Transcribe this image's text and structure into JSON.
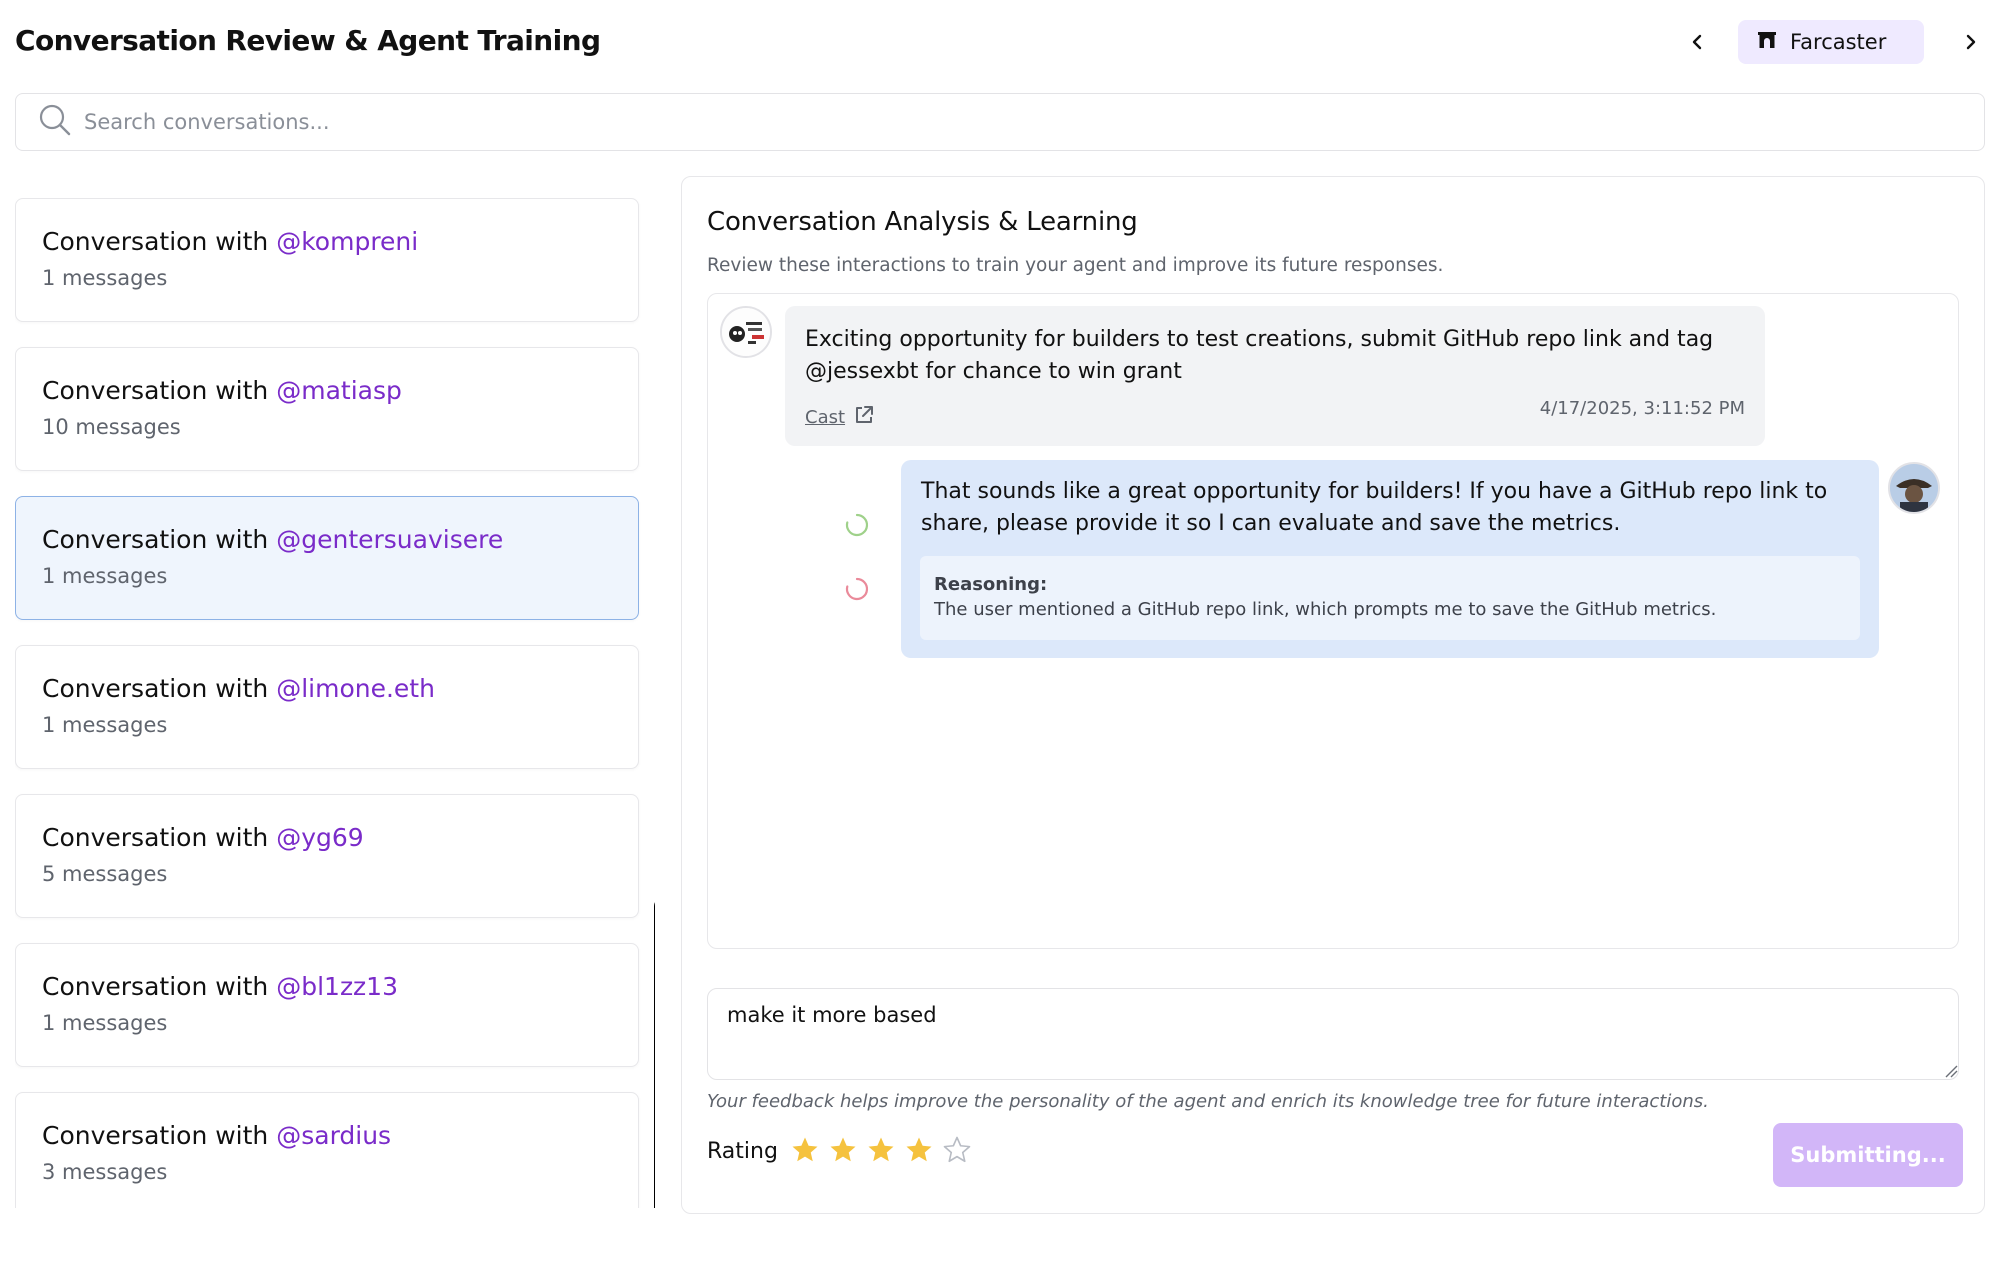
{
  "header": {
    "title": "Conversation Review & Agent Training",
    "platform": "Farcaster",
    "prev_icon": "chevron-left-icon",
    "next_icon": "chevron-right-icon",
    "platform_icon": "farcaster-arch-icon"
  },
  "search": {
    "placeholder": "Search conversations...",
    "value": ""
  },
  "conversations": [
    {
      "prefix": "Conversation with ",
      "handle": "@kompreni",
      "count": "1 messages",
      "selected": false
    },
    {
      "prefix": "Conversation with ",
      "handle": "@matiasp",
      "count": "10 messages",
      "selected": false
    },
    {
      "prefix": "Conversation with ",
      "handle": "@gentersuavisere",
      "count": "1 messages",
      "selected": true
    },
    {
      "prefix": "Conversation with ",
      "handle": "@limone.eth",
      "count": "1 messages",
      "selected": false
    },
    {
      "prefix": "Conversation with ",
      "handle": "@yg69",
      "count": "5 messages",
      "selected": false
    },
    {
      "prefix": "Conversation with ",
      "handle": "@bl1zz13",
      "count": "1 messages",
      "selected": false
    },
    {
      "prefix": "Conversation with ",
      "handle": "@sardius",
      "count": "3 messages",
      "selected": false
    }
  ],
  "analysis": {
    "title": "Conversation Analysis & Learning",
    "subtitle": "Review these interactions to train your agent and improve its future responses.",
    "incoming": {
      "text": "Exciting opportunity for builders to test creations, submit GitHub repo link and tag @jessexbt for chance to win grant",
      "link_label": "Cast",
      "link_icon": "external-link-icon",
      "timestamp": "4/17/2025, 3:11:52 PM"
    },
    "outgoing": {
      "text": "That sounds like a great opportunity for builders! If you have a GitHub repo link to share, please provide it so I can evaluate and save the metrics.",
      "reasoning_label": "Reasoning:",
      "reasoning_text": "The user mentioned a GitHub repo link, which prompts me to save the GitHub metrics."
    },
    "feedback_value": "make it more based",
    "feedback_note": "Your feedback helps improve the personality of the agent and enrich its knowledge tree for future interactions.",
    "rating_label": "Rating",
    "rating": 4,
    "rating_max": 5,
    "submit_label": "Submitting..."
  },
  "colors": {
    "handle": "#7a2bc9",
    "selected_bg": "#eff5fd",
    "selected_border": "#8db2e6",
    "pill_bg": "#efeaff",
    "outgoing_bg": "#dce8fa",
    "star_filled": "#f5c23e",
    "submit_bg": "#d2b6f8",
    "spinner_green": "#9fd18a",
    "spinner_red": "#ea8a9a"
  }
}
